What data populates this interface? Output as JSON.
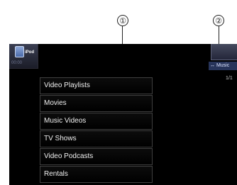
{
  "callouts": {
    "one": "①",
    "two": "②"
  },
  "ipod": {
    "label": "iPod",
    "time": "00:00"
  },
  "menu": {
    "items": [
      {
        "label": "Video Playlists"
      },
      {
        "label": "Movies"
      },
      {
        "label": "Music Videos"
      },
      {
        "label": "TV Shows"
      },
      {
        "label": "Video Podcasts"
      },
      {
        "label": "Rentals"
      }
    ]
  },
  "right": {
    "music_tab": "↔ Music",
    "page_indicator": "1/1"
  },
  "colors": {
    "screen_bg": "#000000",
    "accent_blue": "#27345a"
  }
}
